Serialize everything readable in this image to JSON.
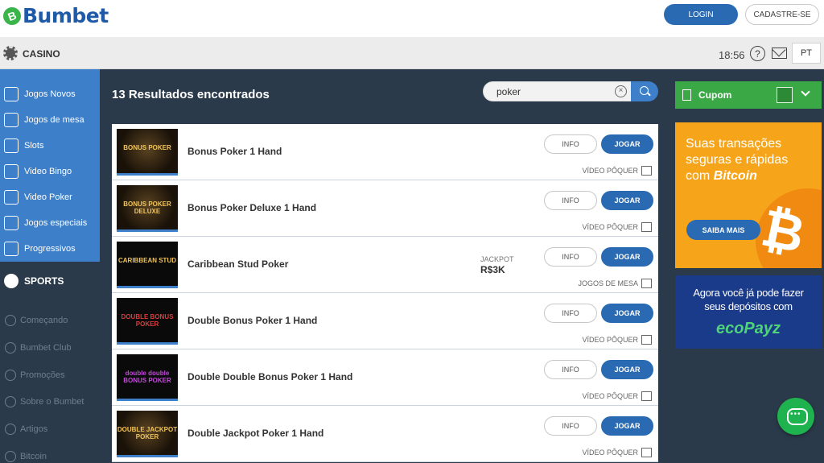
{
  "header": {
    "logo_text": "Bumbet",
    "logo_mark": "B",
    "login_label": "LOGIN",
    "signup_label": "CADASTRE-SE"
  },
  "subbar": {
    "section": "CASINO",
    "time": "18:56",
    "help_glyph": "?",
    "language": "PT"
  },
  "sidebar": {
    "items": [
      {
        "label": "Jogos Novos",
        "icon": "new-badge-icon"
      },
      {
        "label": "Jogos de mesa",
        "icon": "dice-icon"
      },
      {
        "label": "Slots",
        "icon": "slot-machine-icon"
      },
      {
        "label": "Video Bingo",
        "icon": "bingo-icon"
      },
      {
        "label": "Video Poker",
        "icon": "poker-icon"
      },
      {
        "label": "Jogos especiais",
        "icon": "special-grid-icon"
      },
      {
        "label": "Progressivos",
        "icon": "money-bag-icon"
      }
    ],
    "sports": "SPORTS",
    "links": [
      {
        "label": "Começando",
        "icon": "power-icon"
      },
      {
        "label": "Bumbet Club",
        "icon": "club-icon"
      },
      {
        "label": "Promoções",
        "icon": "megaphone-icon"
      },
      {
        "label": "Sobre o Bumbet",
        "icon": "person-icon"
      },
      {
        "label": "Artigos",
        "icon": "article-icon"
      },
      {
        "label": "Bitcoin",
        "icon": "bitcoin-icon"
      }
    ]
  },
  "main": {
    "results_title": "13 Resultados encontrados",
    "search": {
      "value": "poker",
      "clear_glyph": "×"
    },
    "info_label": "INFO",
    "play_label": "JOGAR",
    "games": [
      {
        "name": "Bonus Poker 1 Hand",
        "category": "VÍDEO PÔQUER",
        "thumb": "BONUS POKER",
        "jackpot_label": "",
        "jackpot_value": ""
      },
      {
        "name": "Bonus Poker Deluxe 1 Hand",
        "category": "VÍDEO PÔQUER",
        "thumb": "BONUS POKER DELUXE",
        "jackpot_label": "",
        "jackpot_value": ""
      },
      {
        "name": "Caribbean Stud Poker",
        "category": "JOGOS DE MESA",
        "thumb": "CARIBBEAN STUD",
        "jackpot_label": "JACKPOT",
        "jackpot_value": "R$3K"
      },
      {
        "name": "Double Bonus Poker 1 Hand",
        "category": "VÍDEO PÔQUER",
        "thumb": "DOUBLE BONUS POKER",
        "jackpot_label": "",
        "jackpot_value": ""
      },
      {
        "name": "Double Double Bonus Poker 1 Hand",
        "category": "VÍDEO PÔQUER",
        "thumb": "double double BONUS POKER",
        "jackpot_label": "",
        "jackpot_value": ""
      },
      {
        "name": "Double Jackpot Poker 1 Hand",
        "category": "VÍDEO PÔQUER",
        "thumb": "DOUBLE JACKPOT POKER",
        "jackpot_label": "",
        "jackpot_value": ""
      }
    ]
  },
  "right": {
    "coupon_label": "Cupom",
    "bitcoin_banner": {
      "line1": "Suas transações",
      "line2": "seguras e rápidas",
      "line3_prefix": "com ",
      "line3_brand": "Bitcoin",
      "button": "SAIBA MAIS",
      "symbol": "₿"
    },
    "ecopayz_banner": {
      "text_line1": "Agora você já pode fazer",
      "text_line2": "seus depósitos com",
      "logo": "ecoPayz"
    }
  },
  "colors": {
    "brand_blue": "#2a6ab3",
    "sidebar_blue": "#3e7fc9",
    "dark_bg": "#2b3a4a",
    "coupon_green": "#3aa845",
    "bitcoin_orange": "#f6a51b",
    "ecopayz_blue": "#1a3a8a"
  }
}
